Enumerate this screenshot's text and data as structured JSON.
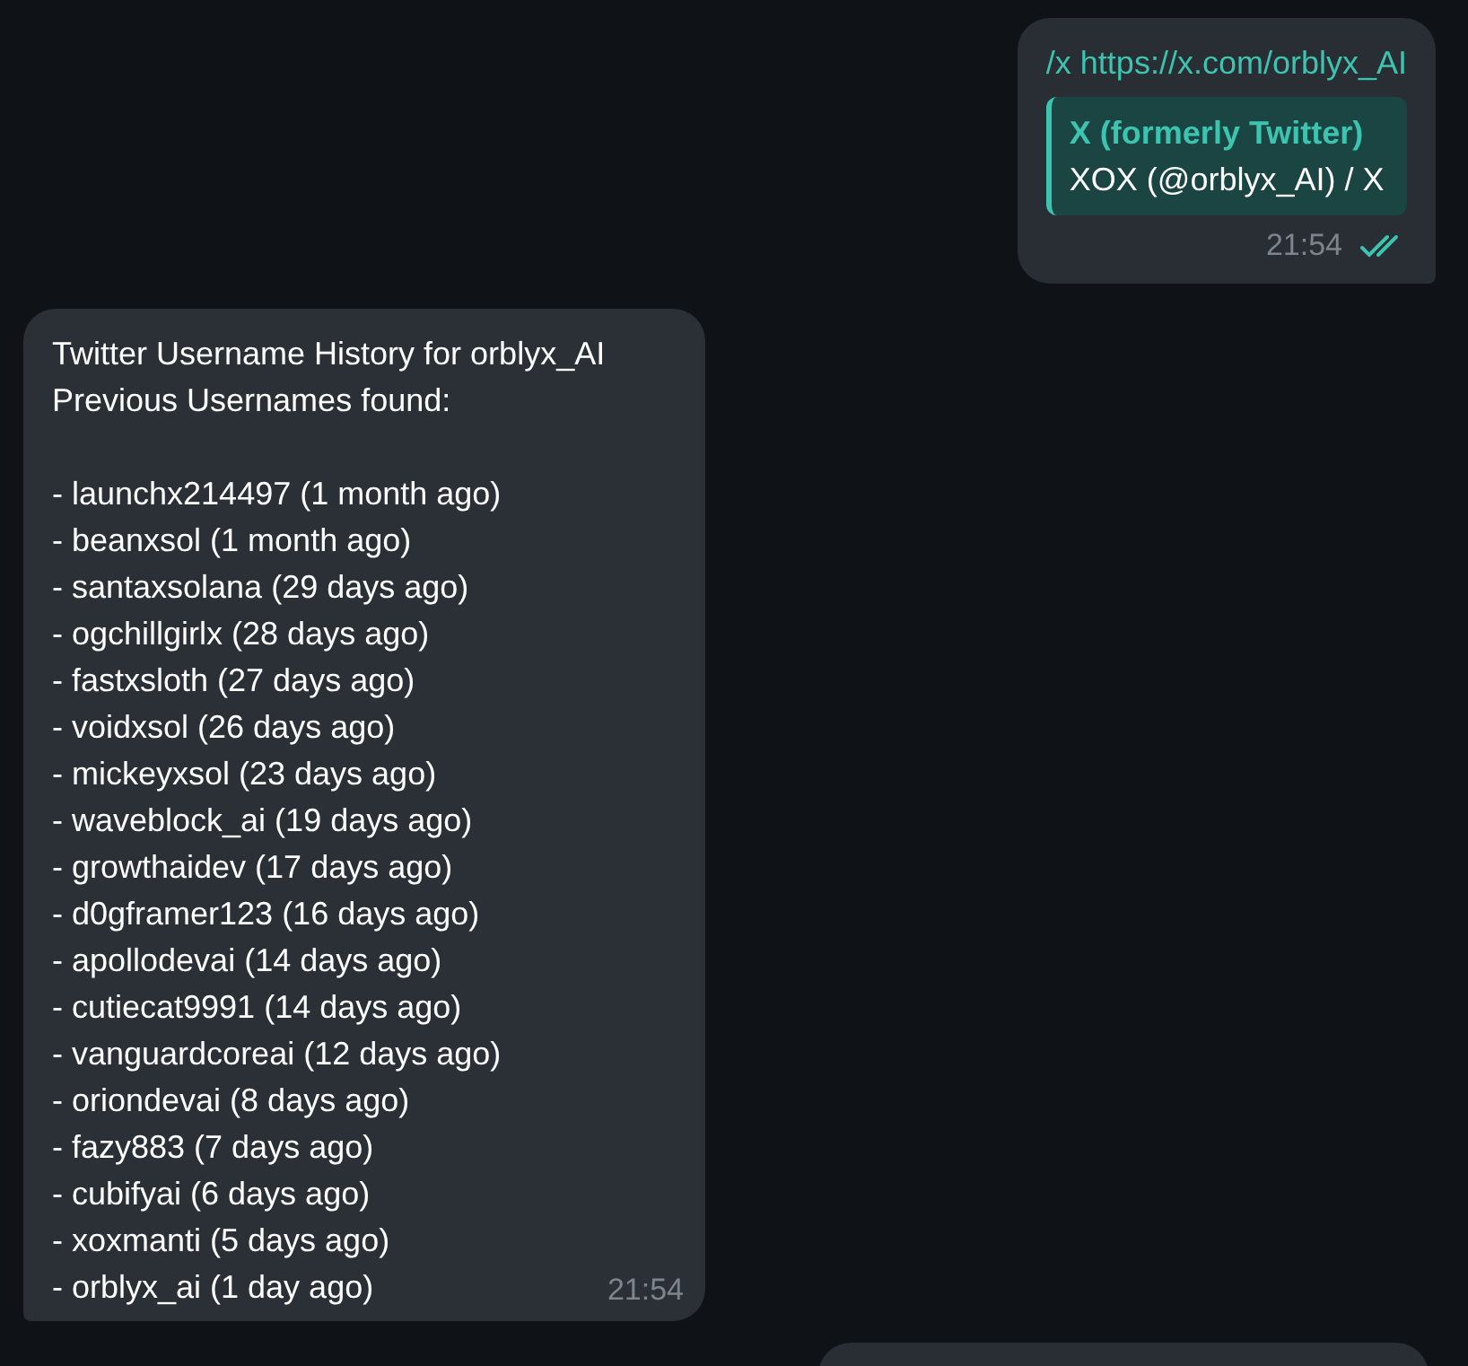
{
  "messages": [
    {
      "kind": "outgoing",
      "command": "/x https://x.com/orblyx_AI",
      "preview": {
        "site": "X (formerly Twitter)",
        "title": "XOX (@orblyx_AI) / X"
      },
      "time": "21:54",
      "read": true
    },
    {
      "kind": "incoming",
      "header": [
        "Twitter Username History for orblyx_AI",
        "Previous Usernames found:"
      ],
      "lines": [
        "- launchx214497 (1 month ago)",
        "- beanxsol (1 month ago)",
        "- santaxsolana (29 days ago)",
        "- ogchillgirlx (28 days ago)",
        "- fastxsloth (27 days ago)",
        "- voidxsol (26 days ago)",
        "- mickeyxsol (23 days ago)",
        "- waveblock_ai (19 days ago)",
        "- growthaidev (17 days ago)",
        "- d0gframer123 (16 days ago)",
        "- apollodevai (14 days ago)",
        "- cutiecat9991 (14 days ago)",
        "- vanguardcoreai (12 days ago)",
        "- oriondevai (8 days ago)",
        "- fazy883 (7 days ago)",
        "- cubifyai (6 days ago)",
        "- xoxmanti (5 days ago)",
        "- orblyx_ai (1 day ago)"
      ],
      "time": "21:54"
    },
    {
      "kind": "partial"
    }
  ]
}
